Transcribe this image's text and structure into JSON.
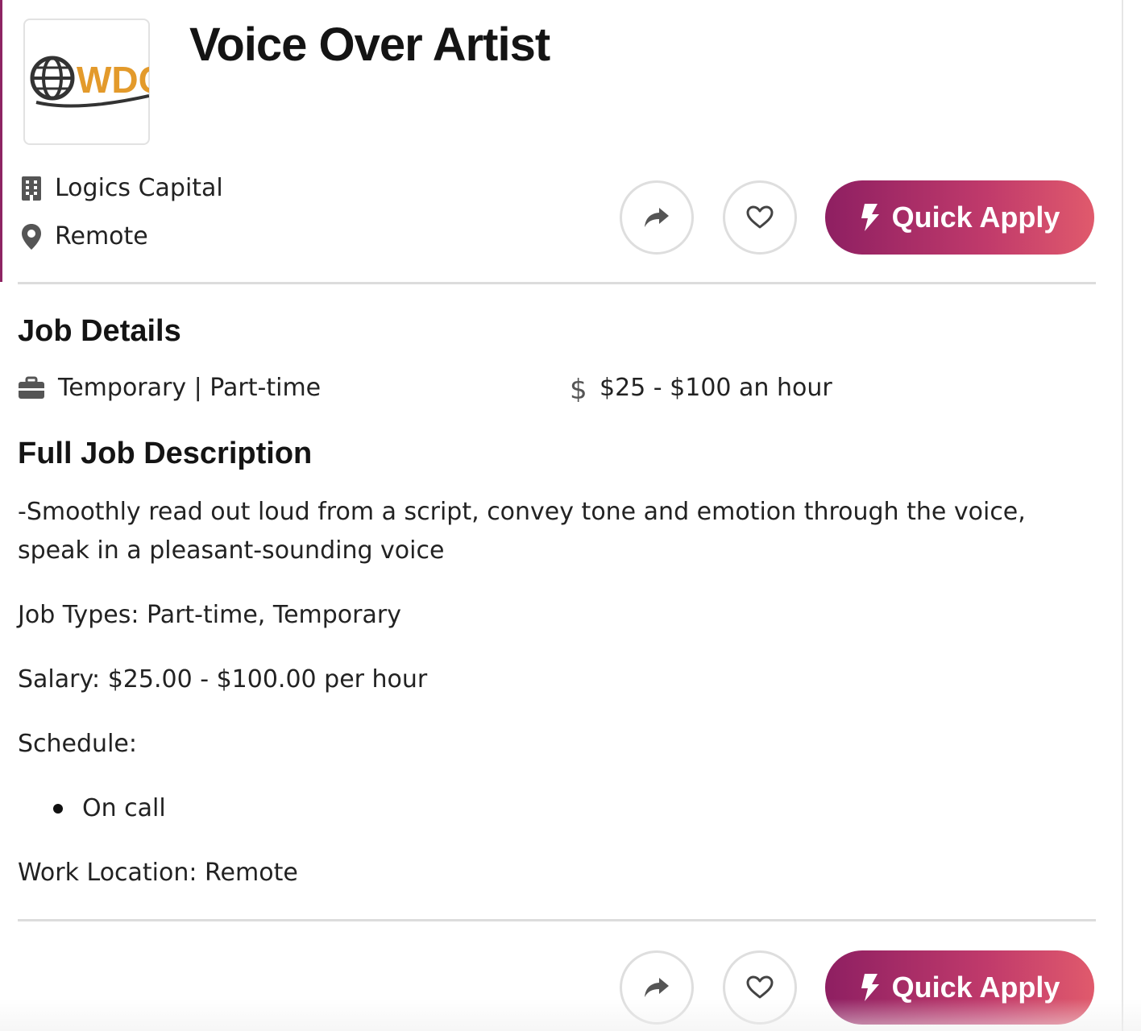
{
  "job": {
    "title": "Voice Over Artist",
    "company": "Logics Capital",
    "location": "Remote",
    "logo_text": "WDC"
  },
  "actions": {
    "quick_apply_label": "Quick Apply",
    "share_icon": "share-arrow-icon",
    "save_icon": "heart-icon"
  },
  "job_details": {
    "heading": "Job Details",
    "job_type": "Temporary | Part-time",
    "pay": "$25 - $100 an hour"
  },
  "description": {
    "heading": "Full Job Description",
    "summary": "-Smoothly read out loud from a script, convey tone and emotion through the voice, speak in a pleasant-sounding voice",
    "job_types": "Job Types: Part-time, Temporary",
    "salary": "Salary: $25.00 - $100.00 per hour",
    "schedule_label": "Schedule:",
    "schedule_items": [
      "On call"
    ],
    "work_location": "Work Location: Remote"
  },
  "colors": {
    "accent": "#8e2463",
    "apply_gradient_start": "#8e1f62",
    "apply_gradient_end": "#e05a6c",
    "logo_orange": "#e39a2b"
  }
}
